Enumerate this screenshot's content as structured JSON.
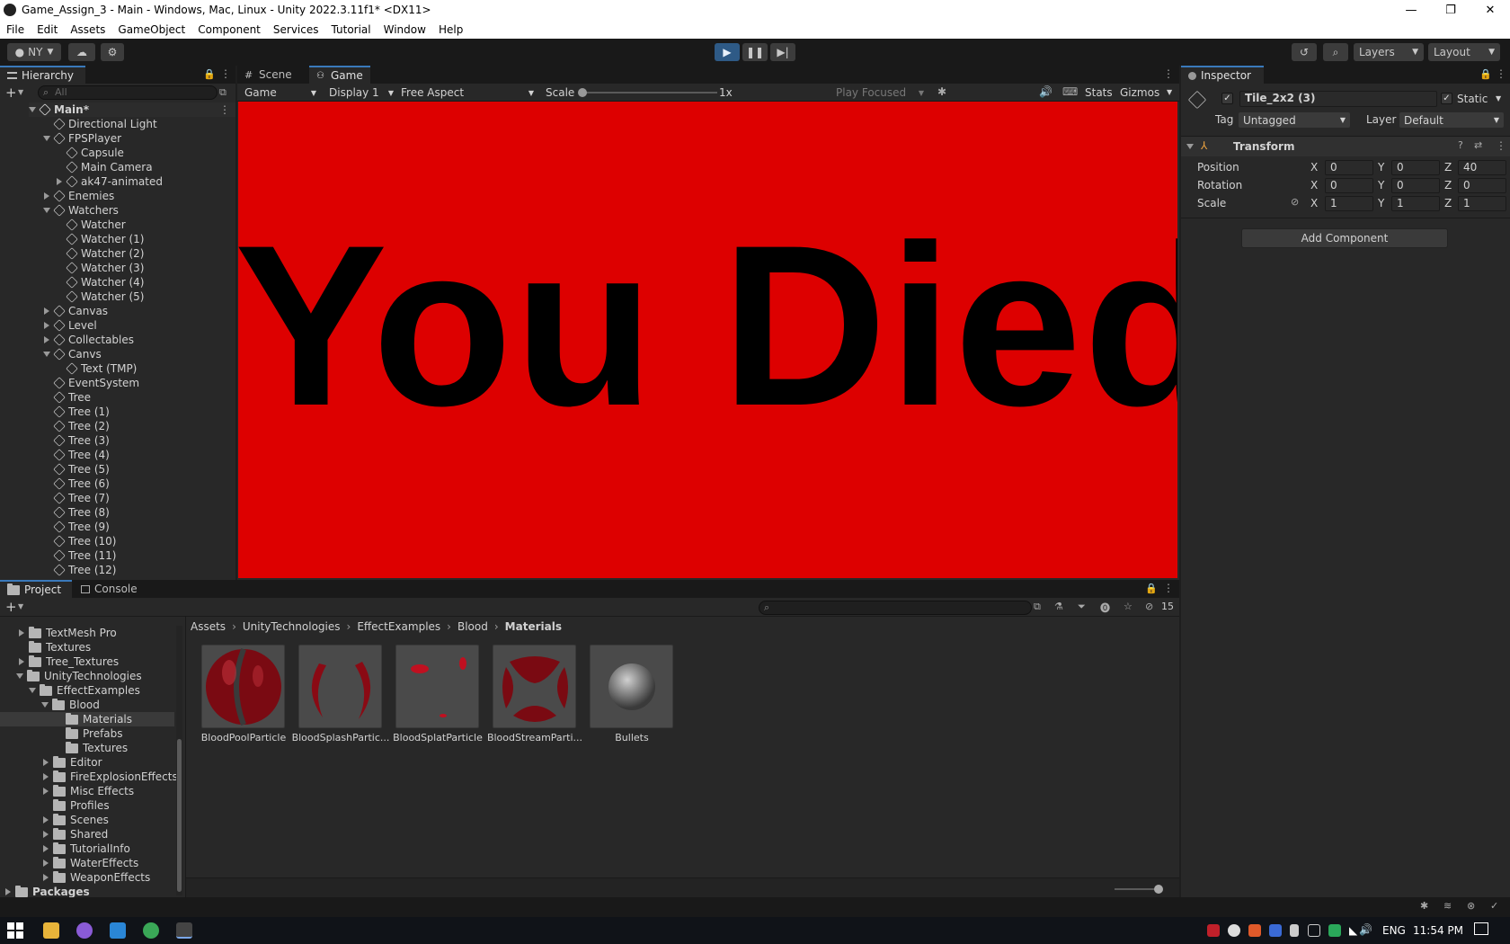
{
  "window": {
    "title": "Game_Assign_3 - Main - Windows, Mac, Linux - Unity 2022.3.11f1* <DX11>",
    "controls": [
      "—",
      "❐",
      "✕"
    ]
  },
  "menu": [
    "File",
    "Edit",
    "Assets",
    "GameObject",
    "Component",
    "Services",
    "Tutorial",
    "Window",
    "Help"
  ],
  "toolbar": {
    "account": "NY",
    "layers": "Layers",
    "layout": "Layout"
  },
  "hierarchy": {
    "tab": "Hierarchy",
    "search_placeholder": "All",
    "scene": "Main*",
    "items": [
      {
        "label": "Directional Light"
      },
      {
        "label": "FPSPlayer"
      },
      {
        "label": "Capsule"
      },
      {
        "label": "Main Camera"
      },
      {
        "label": "ak47-animated"
      },
      {
        "label": "Enemies"
      },
      {
        "label": "Watchers"
      },
      {
        "label": "Watcher"
      },
      {
        "label": "Watcher (1)"
      },
      {
        "label": "Watcher (2)"
      },
      {
        "label": "Watcher (3)"
      },
      {
        "label": "Watcher (4)"
      },
      {
        "label": "Watcher (5)"
      },
      {
        "label": "Canvas"
      },
      {
        "label": "Level"
      },
      {
        "label": "Collectables"
      },
      {
        "label": "Canvs"
      },
      {
        "label": "Text (TMP)"
      },
      {
        "label": "EventSystem"
      },
      {
        "label": "Tree"
      },
      {
        "label": "Tree (1)"
      },
      {
        "label": "Tree (2)"
      },
      {
        "label": "Tree (3)"
      },
      {
        "label": "Tree (4)"
      },
      {
        "label": "Tree (5)"
      },
      {
        "label": "Tree (6)"
      },
      {
        "label": "Tree (7)"
      },
      {
        "label": "Tree (8)"
      },
      {
        "label": "Tree (9)"
      },
      {
        "label": "Tree (10)"
      },
      {
        "label": "Tree (11)"
      },
      {
        "label": "Tree (12)"
      }
    ]
  },
  "game_view": {
    "tabs": [
      "Scene",
      "Game"
    ],
    "mode": "Game",
    "display": "Display 1",
    "aspect": "Free Aspect",
    "scale_label": "Scale",
    "scale_value": "1x",
    "play_focused": "Play Focused",
    "stats": "Stats",
    "gizmos": "Gizmos",
    "message": "You Died",
    "background_color": "#dd0000"
  },
  "inspector": {
    "tab": "Inspector",
    "object_name": "Tile_2x2 (3)",
    "static_label": "Static",
    "tag_label": "Tag",
    "tag_value": "Untagged",
    "layer_label": "Layer",
    "layer_value": "Default",
    "component": "Transform",
    "position_label": "Position",
    "rotation_label": "Rotation",
    "scale_label": "Scale",
    "axis_x": "X",
    "axis_y": "Y",
    "axis_z": "Z",
    "position": {
      "x": "0",
      "y": "0",
      "z": "40"
    },
    "rotation": {
      "x": "0",
      "y": "0",
      "z": "0"
    },
    "scale": {
      "x": "1",
      "y": "1",
      "z": "1"
    },
    "add_component": "Add Component"
  },
  "project": {
    "tabs": [
      "Project",
      "Console"
    ],
    "hidden_count": "15",
    "breadcrumb": [
      "Assets",
      "UnityTechnologies",
      "EffectExamples",
      "Blood",
      "Materials"
    ],
    "tree": [
      {
        "label": "TextMesh Pro"
      },
      {
        "label": "Textures"
      },
      {
        "label": "Tree_Textures"
      },
      {
        "label": "UnityTechnologies"
      },
      {
        "label": "EffectExamples"
      },
      {
        "label": "Blood"
      },
      {
        "label": "Materials"
      },
      {
        "label": "Prefabs"
      },
      {
        "label": "Textures"
      },
      {
        "label": "Editor"
      },
      {
        "label": "FireExplosionEffects"
      },
      {
        "label": "Misc Effects"
      },
      {
        "label": "Profiles"
      },
      {
        "label": "Scenes"
      },
      {
        "label": "Shared"
      },
      {
        "label": "TutorialInfo"
      },
      {
        "label": "WaterEffects"
      },
      {
        "label": "WeaponEffects"
      },
      {
        "label": "Packages"
      }
    ],
    "assets": [
      {
        "label": "BloodPoolParticle"
      },
      {
        "label": "BloodSplashPartic..."
      },
      {
        "label": "BloodSplatParticle"
      },
      {
        "label": "BloodStreamParti..."
      },
      {
        "label": "Bullets"
      }
    ]
  },
  "taskbar": {
    "language": "ENG",
    "time": "11:54 PM"
  }
}
